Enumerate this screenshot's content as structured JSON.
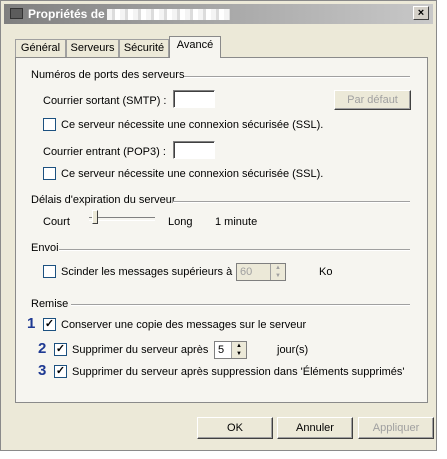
{
  "window": {
    "title": "Propriétés de",
    "close_glyph": "×"
  },
  "tabs": [
    {
      "label": "Général"
    },
    {
      "label": "Serveurs"
    },
    {
      "label": "Sécurité"
    },
    {
      "label": "Avancé"
    }
  ],
  "ports": {
    "section_title": "Numéros de ports des serveurs",
    "smtp_label": "Courrier sortant (SMTP) :",
    "smtp_value": "",
    "default_button": "Par défaut",
    "smtp_ssl_label": "Ce serveur nécessite une connexion sécurisée (SSL).",
    "pop3_label": "Courrier entrant (POP3) :",
    "pop3_value": "",
    "pop3_ssl_label": "Ce serveur nécessite une connexion sécurisée (SSL)."
  },
  "timeout": {
    "section_title": "Délais d'expiration du serveur",
    "short_label": "Court",
    "long_label": "Long",
    "value_label": "1 minute"
  },
  "send": {
    "section_title": "Envoi",
    "split_label": "Scinder les messages supérieurs à",
    "split_value": "60",
    "unit": "Ko"
  },
  "delivery": {
    "section_title": "Remise",
    "keep_copy_label": "Conserver une copie des messages sur le serveur",
    "remove_after_label": "Supprimer du serveur après",
    "remove_after_value": "5",
    "days_unit": "jour(s)",
    "remove_deleted_label": "Supprimer du serveur après suppression dans 'Éléments supprimés'",
    "annotations": [
      "1",
      "2",
      "3"
    ]
  },
  "buttons": {
    "ok": "OK",
    "cancel": "Annuler",
    "apply": "Appliquer"
  },
  "check_glyph": "✓"
}
